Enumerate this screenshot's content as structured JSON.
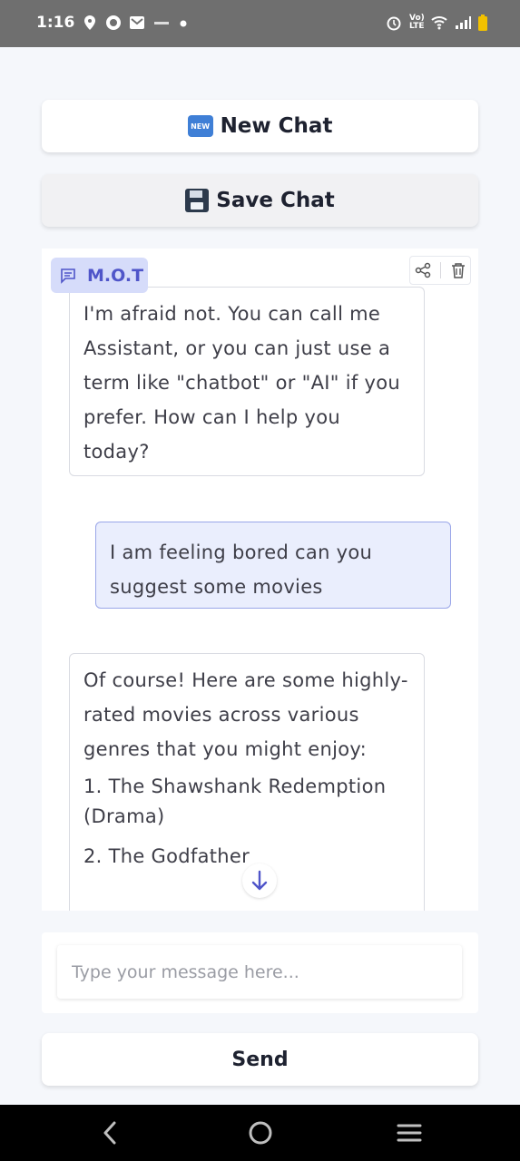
{
  "status_bar": {
    "time": "1:16",
    "network_label": "Vo) LTE"
  },
  "header": {
    "new_chat_label": "New Chat",
    "new_chat_emoji": "NEW",
    "save_chat_label": "Save Chat"
  },
  "chat": {
    "assistant_name": "M.O.T",
    "messages": [
      {
        "role": "assistant",
        "text": "I'm afraid not. You can call me Assistant, or you can just use a term like \"chatbot\" or \"AI\" if you prefer. How can I help you today?"
      },
      {
        "role": "user",
        "text": "I am feeling bored can you suggest some movies"
      },
      {
        "role": "assistant",
        "intro": "Of course! Here are some highly-rated movies across various genres that you might enjoy:",
        "items": [
          "1. The Shawshank Redemption (Drama)",
          "2. The Godfather"
        ]
      }
    ]
  },
  "composer": {
    "placeholder": "Type your message here...",
    "send_label": "Send"
  },
  "colors": {
    "accent": "#4f55c9",
    "badge_bg": "#d6dcfa",
    "user_bubble_bg": "#eaeefd",
    "user_bubble_border": "#9aa6e8"
  },
  "icons": [
    "location-icon",
    "instagram-icon",
    "mail-icon",
    "alarm-icon",
    "wifi-icon",
    "signal-icon",
    "battery-icon",
    "chat-icon",
    "share-icon",
    "trash-icon",
    "arrow-down-icon",
    "back-icon",
    "home-icon",
    "recents-icon"
  ]
}
